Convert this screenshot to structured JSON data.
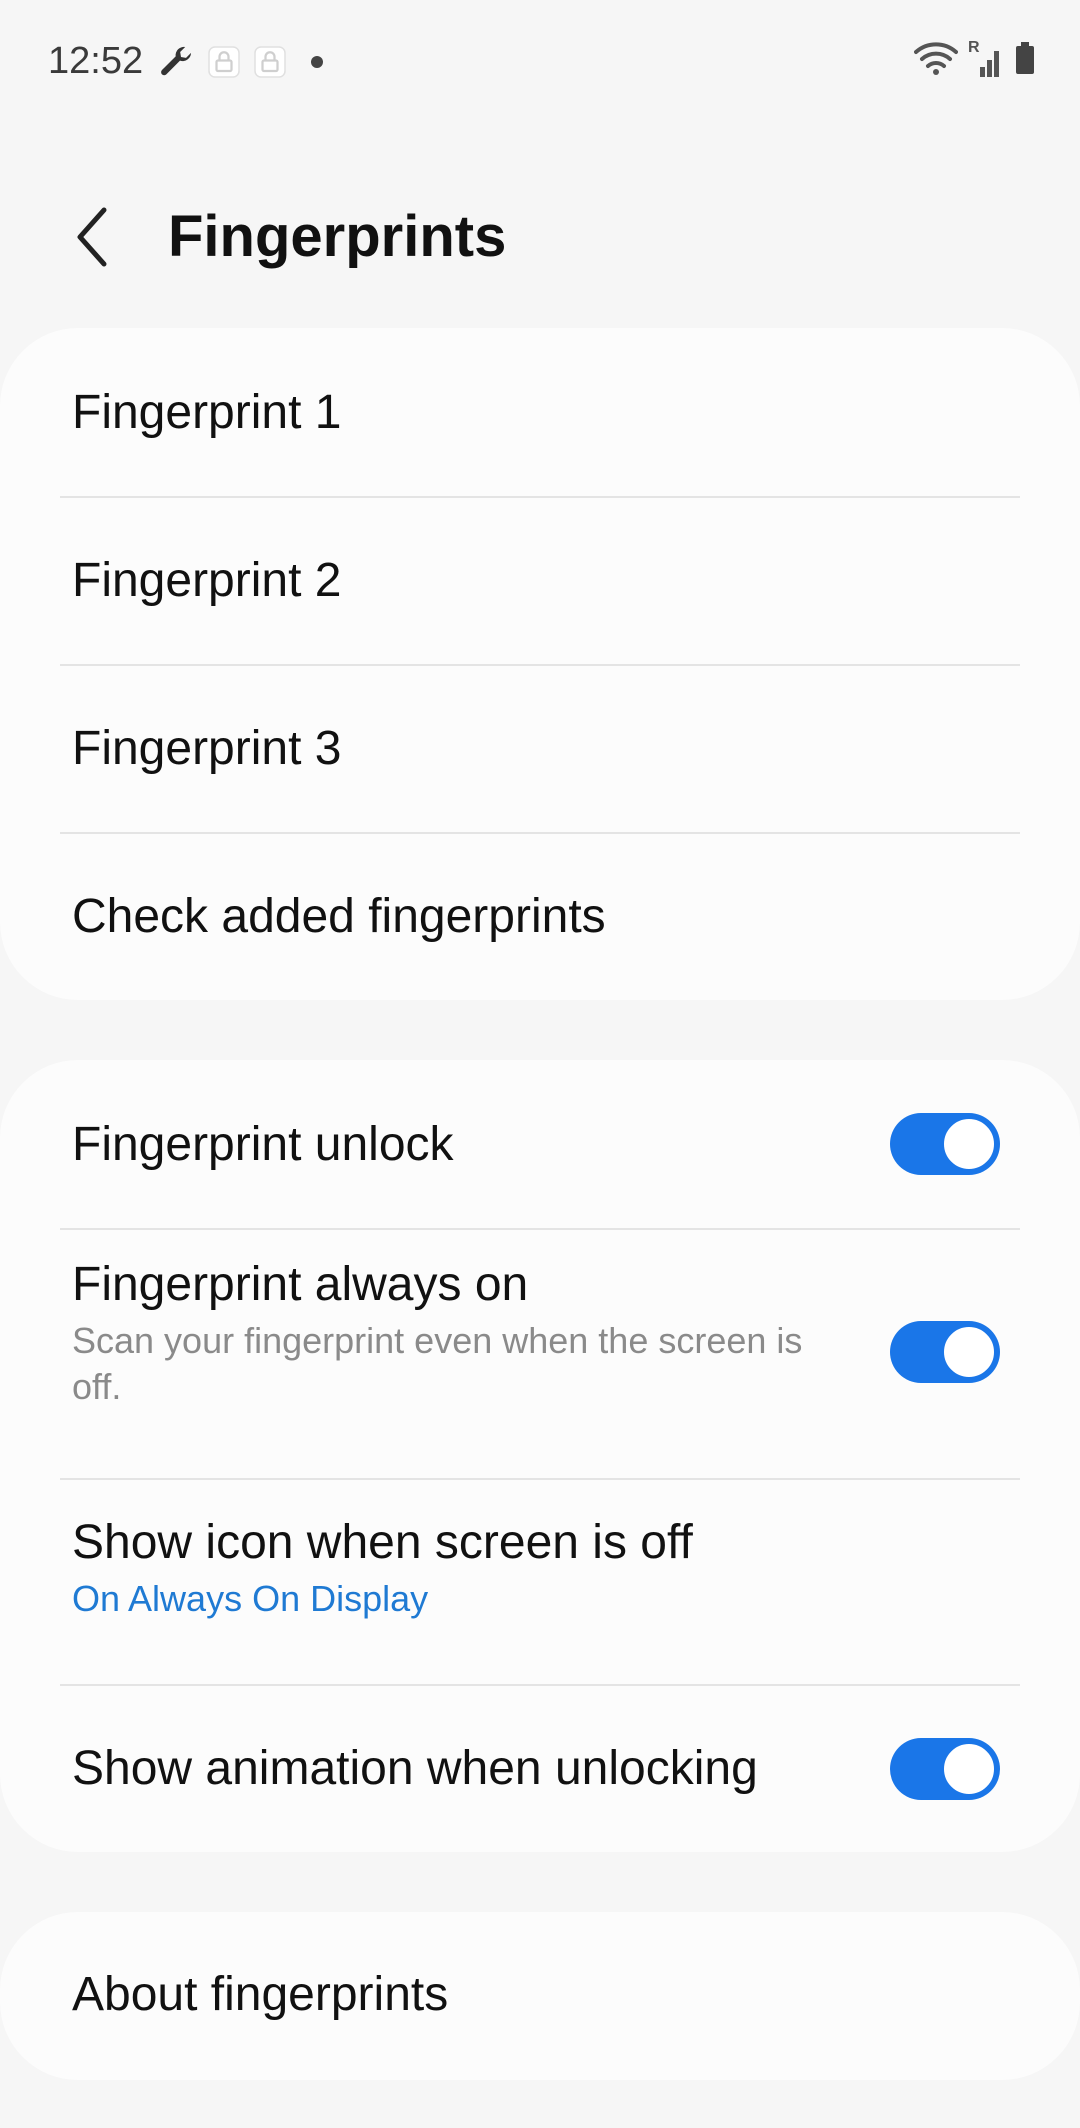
{
  "status_bar": {
    "time": "12:52",
    "left_icons": [
      "wrench-icon",
      "lock-badge-icon",
      "lock-badge-icon",
      "dot-icon"
    ],
    "right_icons": [
      "wifi-icon",
      "signal-roaming-icon",
      "battery-icon"
    ],
    "roaming_label": "R"
  },
  "header": {
    "title": "Fingerprints"
  },
  "fingerprints_card": {
    "items": [
      {
        "label": "Fingerprint 1"
      },
      {
        "label": "Fingerprint 2"
      },
      {
        "label": "Fingerprint 3"
      },
      {
        "label": "Check added fingerprints"
      }
    ]
  },
  "settings_card": {
    "fingerprint_unlock": {
      "label": "Fingerprint unlock",
      "enabled": true
    },
    "always_on": {
      "label": "Fingerprint always on",
      "description": "Scan your fingerprint even when the screen is off.",
      "enabled": true
    },
    "show_icon": {
      "label": "Show icon when screen is off",
      "value": "On Always On Display"
    },
    "show_animation": {
      "label": "Show animation when unlocking",
      "enabled": true
    }
  },
  "about_card": {
    "label": "About fingerprints"
  },
  "colors": {
    "accent": "#1a76e8",
    "link": "#1f7ad3",
    "background": "#f6f6f6",
    "card": "#fcfcfc"
  }
}
